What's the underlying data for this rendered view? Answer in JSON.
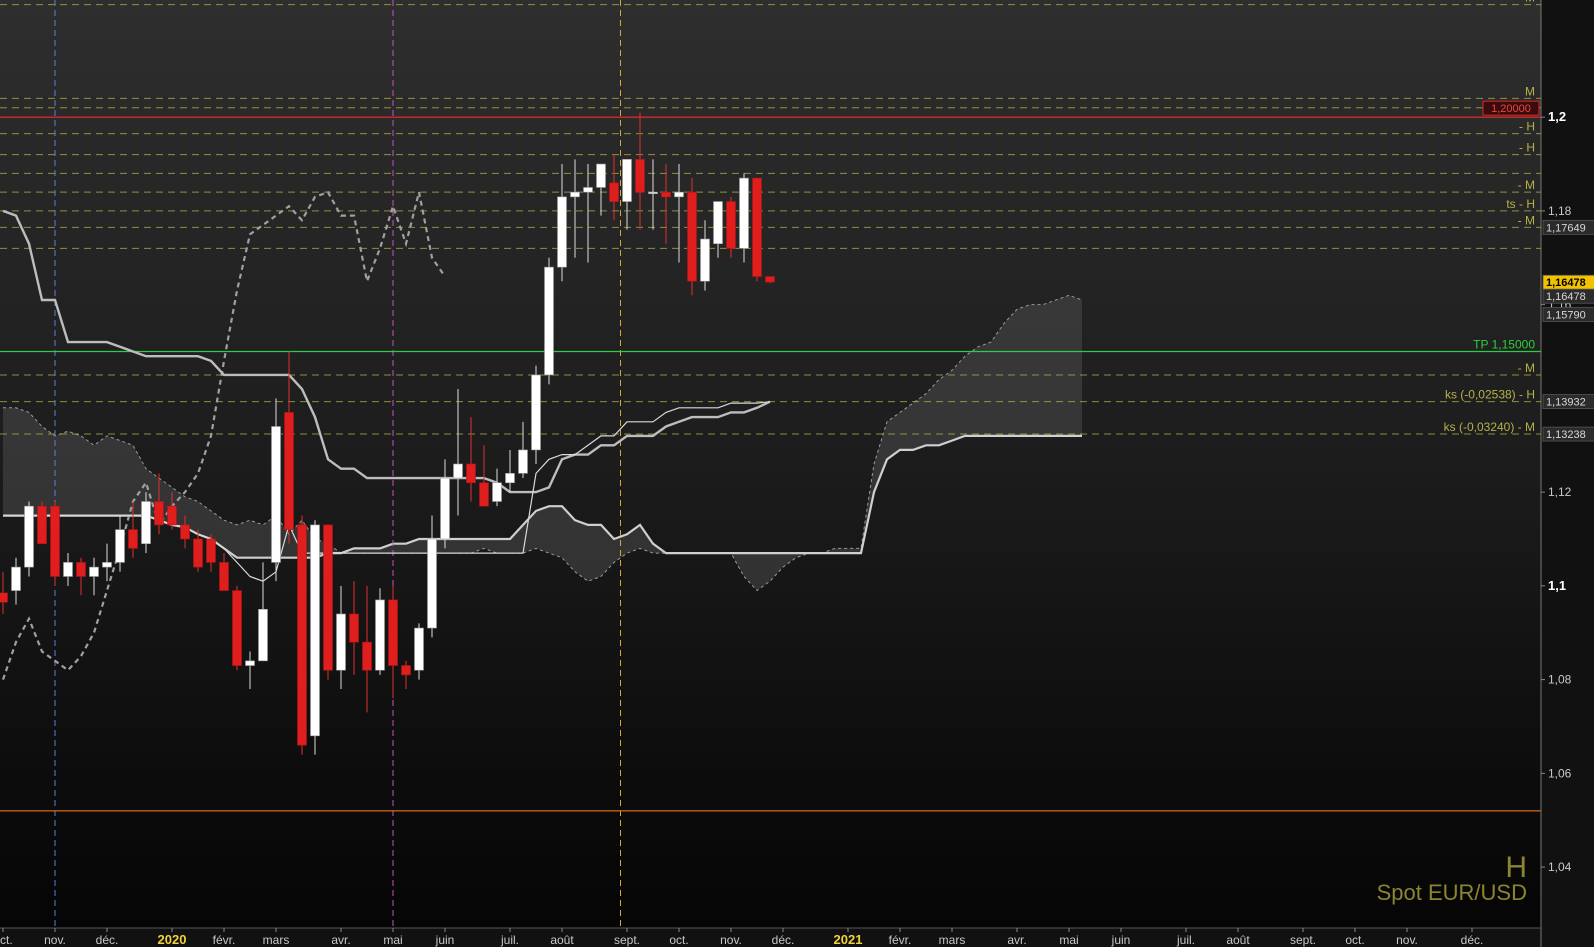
{
  "chart_data": {
    "type": "candlestick",
    "instrument": "Spot EUR/USD",
    "timeframe": "H",
    "ylim": [
      1.027,
      1.225
    ],
    "y_ticks": [
      {
        "value": 1.04,
        "label": "1,04",
        "bold": false
      },
      {
        "value": 1.06,
        "label": "1,06",
        "bold": false
      },
      {
        "value": 1.08,
        "label": "1,08",
        "bold": false
      },
      {
        "value": 1.1,
        "label": "1,1",
        "bold": true
      },
      {
        "value": 1.12,
        "label": "1,12",
        "bold": false
      },
      {
        "value": 1.16,
        "label": "1,16",
        "bold": false
      },
      {
        "value": 1.18,
        "label": "1,18",
        "bold": false
      },
      {
        "value": 1.2,
        "label": "1,2",
        "bold": true
      }
    ],
    "x_ticks": [
      {
        "index": 0,
        "label": "oct.",
        "year": false
      },
      {
        "index": 4,
        "label": "nov.",
        "year": false
      },
      {
        "index": 8,
        "label": "déc.",
        "year": false
      },
      {
        "index": 13,
        "label": "2020",
        "year": true
      },
      {
        "index": 17,
        "label": "févr.",
        "year": false
      },
      {
        "index": 21,
        "label": "mars",
        "year": false
      },
      {
        "index": 26,
        "label": "avr.",
        "year": false
      },
      {
        "index": 30,
        "label": "mai",
        "year": false
      },
      {
        "index": 34,
        "label": "juin",
        "year": false
      },
      {
        "index": 39,
        "label": "juil.",
        "year": false
      },
      {
        "index": 43,
        "label": "août",
        "year": false
      },
      {
        "index": 48,
        "label": "sept.",
        "year": false
      },
      {
        "index": 52,
        "label": "oct.",
        "year": false
      },
      {
        "index": 56,
        "label": "nov.",
        "year": false
      },
      {
        "index": 60,
        "label": "déc.",
        "year": false
      },
      {
        "index": 65,
        "label": "2021",
        "year": true
      },
      {
        "index": 69,
        "label": "févr.",
        "year": false
      },
      {
        "index": 73,
        "label": "mars",
        "year": false
      },
      {
        "index": 78,
        "label": "avr.",
        "year": false
      },
      {
        "index": 82,
        "label": "mai",
        "year": false
      },
      {
        "index": 86,
        "label": "juin",
        "year": false
      },
      {
        "index": 91,
        "label": "juil.",
        "year": false
      },
      {
        "index": 95,
        "label": "août",
        "year": false
      },
      {
        "index": 100,
        "label": "sept.",
        "year": false
      },
      {
        "index": 104,
        "label": "oct.",
        "year": false
      },
      {
        "index": 108,
        "label": "nov.",
        "year": false
      },
      {
        "index": 113,
        "label": "déc.",
        "year": false
      }
    ],
    "candles": [
      {
        "o": 1.0985,
        "h": 1.103,
        "l": 1.094,
        "c": 1.0965
      },
      {
        "o": 1.099,
        "h": 1.106,
        "l": 1.096,
        "c": 1.104
      },
      {
        "o": 1.104,
        "h": 1.118,
        "l": 1.102,
        "c": 1.117
      },
      {
        "o": 1.117,
        "h": 1.118,
        "l": 1.111,
        "c": 1.109
      },
      {
        "o": 1.117,
        "h": 1.118,
        "l": 1.1,
        "c": 1.102
      },
      {
        "o": 1.102,
        "h": 1.107,
        "l": 1.1,
        "c": 1.105
      },
      {
        "o": 1.105,
        "h": 1.106,
        "l": 1.098,
        "c": 1.102
      },
      {
        "o": 1.102,
        "h": 1.106,
        "l": 1.098,
        "c": 1.104
      },
      {
        "o": 1.104,
        "h": 1.109,
        "l": 1.101,
        "c": 1.105
      },
      {
        "o": 1.105,
        "h": 1.115,
        "l": 1.103,
        "c": 1.112
      },
      {
        "o": 1.112,
        "h": 1.118,
        "l": 1.106,
        "c": 1.108
      },
      {
        "o": 1.109,
        "h": 1.12,
        "l": 1.107,
        "c": 1.118
      },
      {
        "o": 1.118,
        "h": 1.124,
        "l": 1.111,
        "c": 1.113
      },
      {
        "o": 1.117,
        "h": 1.12,
        "l": 1.112,
        "c": 1.113
      },
      {
        "o": 1.113,
        "h": 1.115,
        "l": 1.108,
        "c": 1.11
      },
      {
        "o": 1.11,
        "h": 1.112,
        "l": 1.103,
        "c": 1.104
      },
      {
        "o": 1.11,
        "h": 1.111,
        "l": 1.103,
        "c": 1.105
      },
      {
        "o": 1.105,
        "h": 1.107,
        "l": 1.099,
        "c": 1.099
      },
      {
        "o": 1.099,
        "h": 1.1,
        "l": 1.082,
        "c": 1.083
      },
      {
        "o": 1.083,
        "h": 1.086,
        "l": 1.078,
        "c": 1.084
      },
      {
        "o": 1.084,
        "h": 1.105,
        "l": 1.084,
        "c": 1.095
      },
      {
        "o": 1.105,
        "h": 1.14,
        "l": 1.101,
        "c": 1.134
      },
      {
        "o": 1.137,
        "h": 1.15,
        "l": 1.109,
        "c": 1.112
      },
      {
        "o": 1.113,
        "h": 1.115,
        "l": 1.064,
        "c": 1.066
      },
      {
        "o": 1.068,
        "h": 1.114,
        "l": 1.064,
        "c": 1.113
      },
      {
        "o": 1.113,
        "h": 1.113,
        "l": 1.08,
        "c": 1.082
      },
      {
        "o": 1.082,
        "h": 1.1,
        "l": 1.078,
        "c": 1.094
      },
      {
        "o": 1.094,
        "h": 1.101,
        "l": 1.081,
        "c": 1.088
      },
      {
        "o": 1.088,
        "h": 1.1,
        "l": 1.073,
        "c": 1.082
      },
      {
        "o": 1.082,
        "h": 1.0995,
        "l": 1.081,
        "c": 1.097
      },
      {
        "o": 1.097,
        "h": 1.1,
        "l": 1.076,
        "c": 1.083
      },
      {
        "o": 1.083,
        "h": 1.084,
        "l": 1.078,
        "c": 1.081
      },
      {
        "o": 1.082,
        "h": 1.092,
        "l": 1.08,
        "c": 1.091
      },
      {
        "o": 1.091,
        "h": 1.115,
        "l": 1.089,
        "c": 1.11
      },
      {
        "o": 1.11,
        "h": 1.127,
        "l": 1.108,
        "c": 1.123
      },
      {
        "o": 1.123,
        "h": 1.142,
        "l": 1.115,
        "c": 1.126
      },
      {
        "o": 1.126,
        "h": 1.136,
        "l": 1.118,
        "c": 1.122
      },
      {
        "o": 1.122,
        "h": 1.13,
        "l": 1.117,
        "c": 1.117
      },
      {
        "o": 1.118,
        "h": 1.125,
        "l": 1.117,
        "c": 1.122
      },
      {
        "o": 1.122,
        "h": 1.129,
        "l": 1.12,
        "c": 1.124
      },
      {
        "o": 1.124,
        "h": 1.135,
        "l": 1.123,
        "c": 1.129
      },
      {
        "o": 1.129,
        "h": 1.147,
        "l": 1.126,
        "c": 1.145
      },
      {
        "o": 1.145,
        "h": 1.17,
        "l": 1.143,
        "c": 1.168
      },
      {
        "o": 1.168,
        "h": 1.19,
        "l": 1.165,
        "c": 1.183
      },
      {
        "o": 1.183,
        "h": 1.191,
        "l": 1.17,
        "c": 1.184
      },
      {
        "o": 1.184,
        "h": 1.19,
        "l": 1.169,
        "c": 1.185
      },
      {
        "o": 1.185,
        "h": 1.19,
        "l": 1.179,
        "c": 1.19
      },
      {
        "o": 1.186,
        "h": 1.192,
        "l": 1.178,
        "c": 1.182
      },
      {
        "o": 1.182,
        "h": 1.191,
        "l": 1.176,
        "c": 1.191
      },
      {
        "o": 1.191,
        "h": 1.201,
        "l": 1.176,
        "c": 1.184
      },
      {
        "o": 1.184,
        "h": 1.191,
        "l": 1.176,
        "c": 1.184
      },
      {
        "o": 1.184,
        "h": 1.19,
        "l": 1.173,
        "c": 1.183
      },
      {
        "o": 1.183,
        "h": 1.19,
        "l": 1.169,
        "c": 1.184
      },
      {
        "o": 1.184,
        "h": 1.187,
        "l": 1.162,
        "c": 1.165
      },
      {
        "o": 1.165,
        "h": 1.178,
        "l": 1.163,
        "c": 1.174
      },
      {
        "o": 1.173,
        "h": 1.182,
        "l": 1.17,
        "c": 1.182
      },
      {
        "o": 1.182,
        "h": 1.183,
        "l": 1.17,
        "c": 1.172
      },
      {
        "o": 1.172,
        "h": 1.188,
        "l": 1.169,
        "c": 1.187
      },
      {
        "o": 1.187,
        "h": 1.187,
        "l": 1.165,
        "c": 1.166
      },
      {
        "o": 1.166,
        "h": 1.166,
        "l": 1.1645,
        "c": 1.1648
      }
    ],
    "tenkan": {
      "start": 0,
      "values": [
        1.115,
        1.115,
        1.115,
        1.115,
        1.115,
        1.115,
        1.115,
        1.115,
        1.115,
        1.115,
        1.115,
        1.115,
        1.114,
        1.113,
        1.1125,
        1.111,
        1.11,
        1.108,
        1.105,
        1.102,
        1.101,
        1.103,
        1.113,
        1.107,
        1.107,
        1.107,
        1.107,
        1.107,
        1.107,
        1.107,
        1.107,
        1.107,
        1.107,
        1.107,
        1.107,
        1.107,
        1.107,
        1.107,
        1.107,
        1.107,
        1.107,
        1.124,
        1.127,
        1.128,
        1.128,
        1.13,
        1.132,
        1.132,
        1.135,
        1.135,
        1.135,
        1.137,
        1.138,
        1.138,
        1.138,
        1.138,
        1.139,
        1.139,
        1.139,
        1.1393
      ]
    },
    "kijun": {
      "start": 0,
      "values": [
        1.18,
        1.179,
        1.173,
        1.161,
        1.161,
        1.152,
        1.152,
        1.152,
        1.152,
        1.151,
        1.15,
        1.149,
        1.149,
        1.149,
        1.149,
        1.149,
        1.148,
        1.145,
        1.145,
        1.145,
        1.145,
        1.145,
        1.145,
        1.142,
        1.136,
        1.127,
        1.125,
        1.125,
        1.123,
        1.123,
        1.123,
        1.123,
        1.123,
        1.123,
        1.123,
        1.123,
        1.123,
        1.123,
        1.122,
        1.12,
        1.12,
        1.12,
        1.121,
        1.127,
        1.128,
        1.128,
        1.13,
        1.13,
        1.132,
        1.132,
        1.132,
        1.134,
        1.135,
        1.136,
        1.136,
        1.136,
        1.137,
        1.137,
        1.138,
        1.1393
      ]
    },
    "chikou": {
      "start": 0,
      "values": [
        1.08,
        1.088,
        1.093,
        1.086,
        1.084,
        1.082,
        1.085,
        1.09,
        1.099,
        1.108,
        1.118,
        1.122,
        1.113,
        1.117,
        1.12,
        1.124,
        1.132,
        1.148,
        1.163,
        1.175,
        1.177,
        1.179,
        1.181,
        1.178,
        1.183,
        1.184,
        1.179,
        1.179,
        1.165,
        1.172,
        1.181,
        1.173,
        1.184,
        1.17,
        1.166
      ]
    },
    "ssa": {
      "start": 0,
      "values": [
        1.138,
        1.138,
        1.137,
        1.134,
        1.132,
        1.133,
        1.132,
        1.13,
        1.132,
        1.131,
        1.13,
        1.125,
        1.123,
        1.121,
        1.119,
        1.118,
        1.116,
        1.114,
        1.113,
        1.114,
        1.113,
        1.115,
        1.111,
        1.114,
        1.11,
        1.109,
        1.107,
        1.107,
        1.107,
        1.107,
        1.107,
        1.107,
        1.107,
        1.107,
        1.107,
        1.107,
        1.107,
        1.108,
        1.107,
        1.107,
        1.107,
        1.108,
        1.107,
        1.106,
        1.103,
        1.101,
        1.102,
        1.105,
        1.107,
        1.108,
        1.107,
        1.107,
        1.107,
        1.107,
        1.107,
        1.107,
        1.107,
        1.102,
        1.099,
        1.101,
        1.104,
        1.106,
        1.107,
        1.107,
        1.108,
        1.108,
        1.108,
        1.126,
        1.135,
        1.137,
        1.139,
        1.141,
        1.144,
        1.146,
        1.149,
        1.151,
        1.152,
        1.156,
        1.159,
        1.16,
        1.16,
        1.161,
        1.162,
        1.161
      ]
    },
    "ssb": {
      "start": 0,
      "values": [
        1.115,
        1.115,
        1.115,
        1.115,
        1.115,
        1.115,
        1.115,
        1.115,
        1.115,
        1.115,
        1.115,
        1.115,
        1.114,
        1.113,
        1.1125,
        1.111,
        1.11,
        1.108,
        1.106,
        1.106,
        1.106,
        1.106,
        1.106,
        1.106,
        1.106,
        1.107,
        1.107,
        1.108,
        1.108,
        1.108,
        1.109,
        1.109,
        1.11,
        1.11,
        1.11,
        1.11,
        1.11,
        1.11,
        1.11,
        1.11,
        1.113,
        1.116,
        1.117,
        1.117,
        1.114,
        1.113,
        1.113,
        1.11,
        1.111,
        1.113,
        1.109,
        1.107,
        1.107,
        1.107,
        1.107,
        1.107,
        1.107,
        1.107,
        1.107,
        1.107,
        1.107,
        1.107,
        1.107,
        1.107,
        1.107,
        1.107,
        1.107,
        1.12,
        1.127,
        1.129,
        1.129,
        1.13,
        1.13,
        1.131,
        1.132,
        1.132,
        1.132,
        1.132,
        1.132,
        1.132,
        1.132,
        1.132,
        1.132,
        1.132
      ]
    },
    "levels": [
      {
        "value": 1.224,
        "label": "- M",
        "color": "#b5b24a",
        "style": "dash"
      },
      {
        "value": 1.204,
        "label": "M",
        "color": "#b5b24a",
        "style": "dash"
      },
      {
        "value": 1.202,
        "label": "",
        "color": "#b5b24a",
        "style": "dash"
      },
      {
        "value": 1.2,
        "label": "",
        "color": "#d42b2b",
        "style": "solid",
        "badge": "1,20000",
        "badge_bg": "#3a0c0c",
        "badge_fg": "#f04545"
      },
      {
        "value": 1.1965,
        "label": "- H",
        "color": "#b5b24a",
        "style": "dash"
      },
      {
        "value": 1.192,
        "label": "- H",
        "color": "#b5b24a",
        "style": "dash"
      },
      {
        "value": 1.188,
        "label": "",
        "color": "#b5b24a",
        "style": "dash"
      },
      {
        "value": 1.184,
        "label": "- M",
        "color": "#b5b24a",
        "style": "dash"
      },
      {
        "value": 1.18,
        "label": "ts - H",
        "color": "#b5b24a",
        "style": "dash"
      },
      {
        "value": 1.1765,
        "label": "- M",
        "color": "#b5b24a",
        "style": "dash"
      },
      {
        "value": 1.172,
        "label": "",
        "color": "#b5b24a",
        "style": "dash"
      },
      {
        "value": 1.15,
        "label": "TP 1,15000",
        "color": "#2ecc40",
        "style": "solid"
      },
      {
        "value": 1.145,
        "label": "- M",
        "color": "#b5b24a",
        "style": "dash"
      },
      {
        "value": 1.1393,
        "label": "ks (-0,02538) - H",
        "color": "#b5b24a",
        "style": "dash"
      },
      {
        "value": 1.1324,
        "label": "ks (-0,03240) - M",
        "color": "#b5b24a",
        "style": "dash"
      },
      {
        "value": 1.052,
        "label": "",
        "color": "#c0621d",
        "style": "solid"
      }
    ],
    "price_badges": [
      {
        "value": 1.17649,
        "label": "1,17649",
        "bg": "#2b2b2b",
        "fg": "#d8d8d8"
      },
      {
        "value": 1.16478,
        "label": "1,16478",
        "bg": "#f2c200",
        "fg": "#000000"
      },
      {
        "value": 1.16478,
        "label": "1,16478",
        "bg": "#2b2b2b",
        "fg": "#d8d8d8",
        "offset": 1
      },
      {
        "value": 1.1579,
        "label": "1,15790",
        "bg": "#2b2b2b",
        "fg": "#d8d8d8"
      },
      {
        "value": 1.13932,
        "label": "1,13932",
        "bg": "#2b2b2b",
        "fg": "#d8d8d8"
      },
      {
        "value": 1.13238,
        "label": "1,13238",
        "bg": "#2b2b2b",
        "fg": "#d8d8d8"
      }
    ],
    "vlines": [
      {
        "index": 4,
        "color": "#5f7fd8"
      },
      {
        "index": 30,
        "color": "#c254c2"
      },
      {
        "index": 47.5,
        "color": "#d8a63a"
      }
    ],
    "colors": {
      "bull": "#ffffff",
      "bear": "#e01e1e",
      "cloud": "#4a4a4a",
      "line": "#bdbdbd"
    }
  },
  "watermark": {
    "timeframe": "H",
    "instrument": "Spot EUR/USD"
  }
}
